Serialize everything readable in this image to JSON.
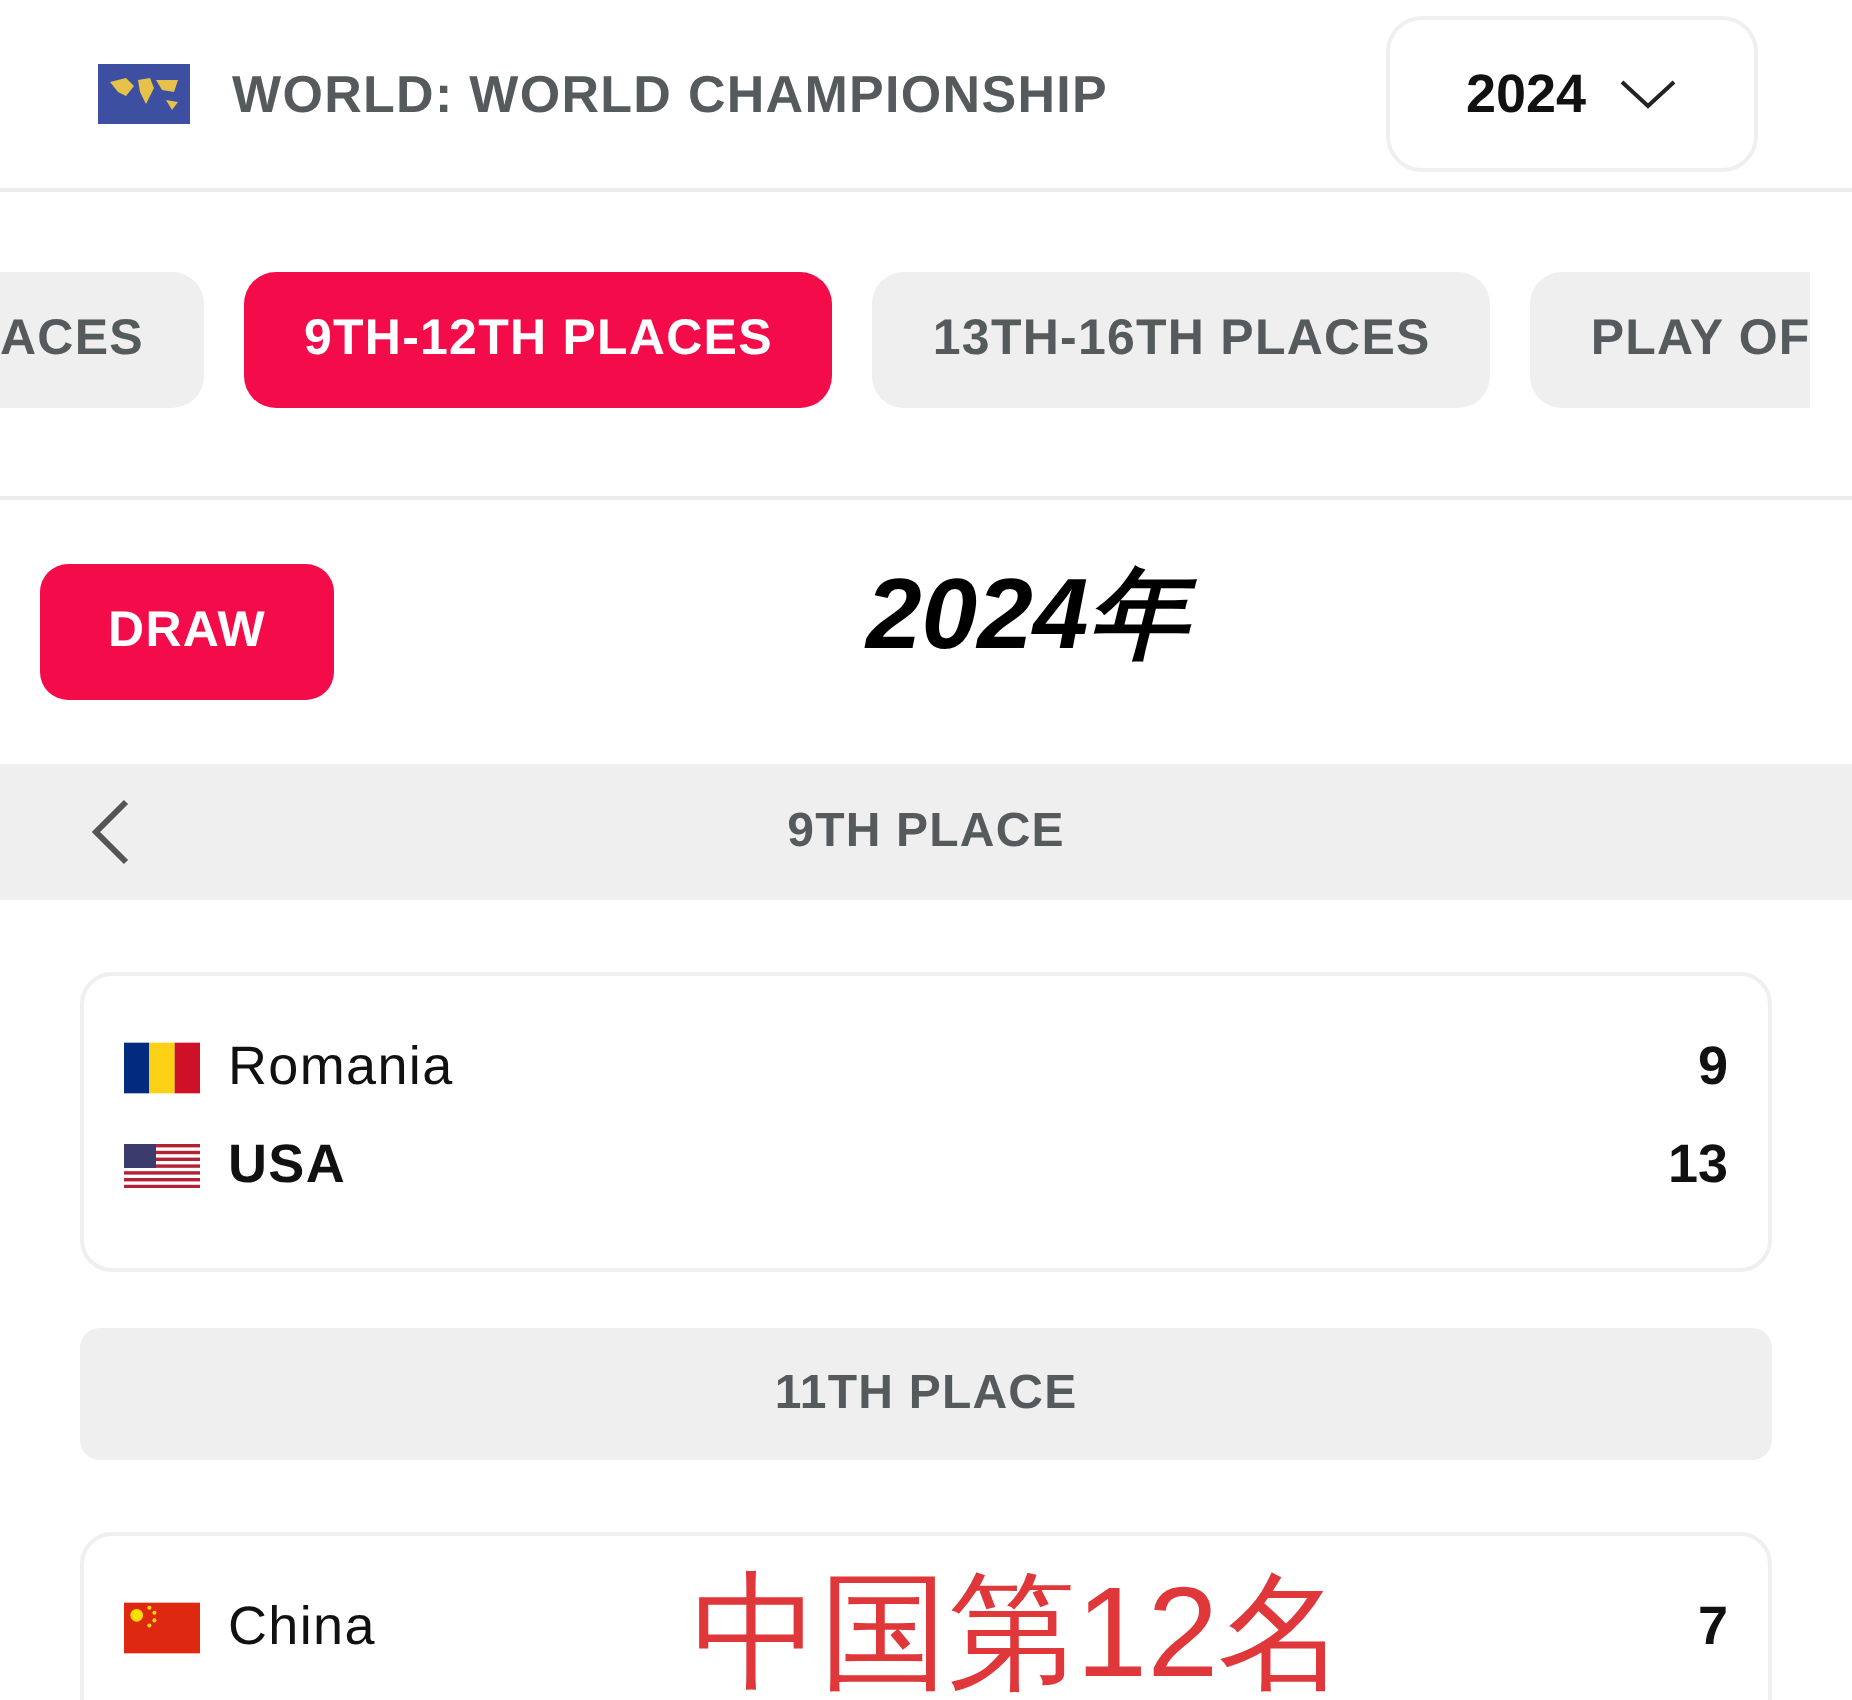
{
  "header": {
    "title": "WORLD: WORLD CHAMPIONSHIP",
    "year": "2024"
  },
  "tabs": [
    {
      "label": "ACES",
      "selected": false
    },
    {
      "label": "9TH-12TH PLACES",
      "selected": true
    },
    {
      "label": "13TH-16TH PLACES",
      "selected": false
    },
    {
      "label": "PLAY OF",
      "selected": false
    }
  ],
  "draw_button": "DRAW",
  "annotations": [
    {
      "text": "2024年",
      "kind": "heading"
    },
    {
      "text": "中国第12名",
      "kind": "note"
    }
  ],
  "sections": [
    {
      "title": "9TH PLACE",
      "kind": "nav",
      "matches": [
        [
          {
            "team": "Romania",
            "kind": "romania",
            "score": "9",
            "winner": false
          },
          {
            "team": "USA",
            "kind": "usa",
            "score": "13",
            "winner": true
          }
        ]
      ]
    },
    {
      "title": "11TH PLACE",
      "kind": "plain",
      "matches": [
        [
          {
            "team": "China",
            "kind": "china",
            "score": "7",
            "winner": false
          }
        ]
      ]
    }
  ]
}
